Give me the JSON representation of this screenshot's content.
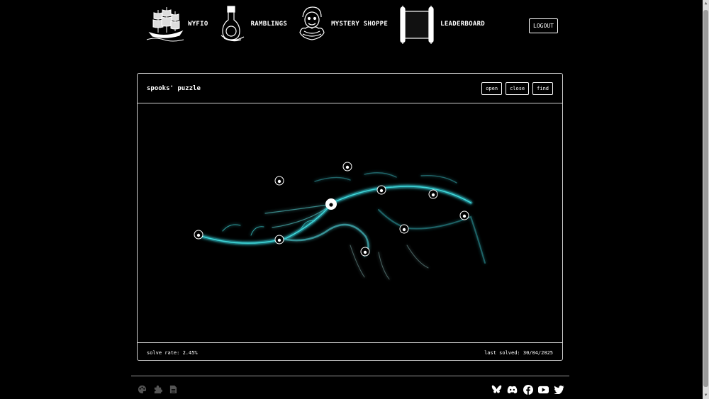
{
  "nav": {
    "items": [
      {
        "label": "WYFIO",
        "icon": "ship-icon"
      },
      {
        "label": "RAMBLINGS",
        "icon": "bottle-icon"
      },
      {
        "label": "MYSTERY SHOPPE",
        "icon": "jester-icon"
      },
      {
        "label": "LEADERBOARD",
        "icon": "scroll-icon"
      }
    ],
    "logout_label": "LOGOUT"
  },
  "puzzle": {
    "title": "spooks' puzzle",
    "buttons": {
      "open": "open",
      "close": "close",
      "find": "find"
    },
    "solve_rate": "solve rate: 2.45%",
    "last_solved": "last solved: 30/04/2025",
    "colors": {
      "fractal": "#3fd6d8",
      "fractal_dim": "#1c7b83",
      "marker": "#ffffff"
    }
  },
  "footer": {
    "left_icons": [
      "palette-icon",
      "puzzle-piece-icon",
      "document-icon"
    ],
    "right_icons": [
      "bluesky-icon",
      "discord-icon",
      "facebook-icon",
      "youtube-icon",
      "twitter-icon"
    ]
  }
}
